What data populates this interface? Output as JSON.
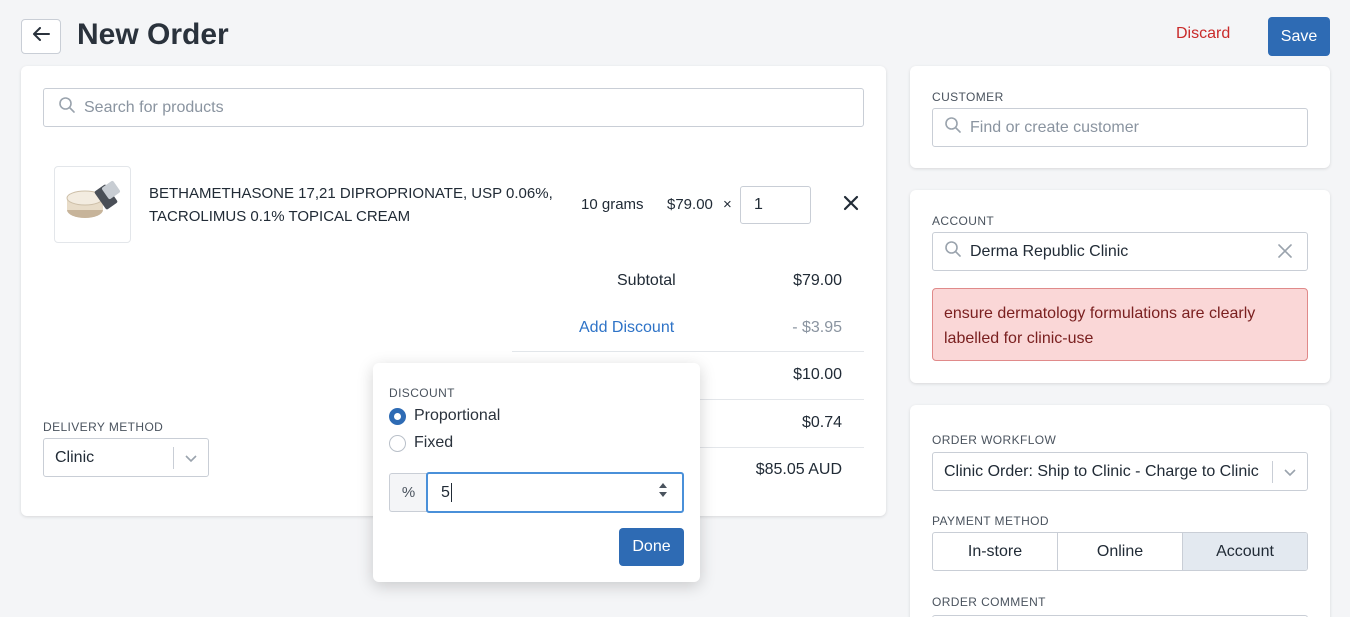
{
  "header": {
    "back_icon": "arrow-left-icon",
    "title": "New Order",
    "discard_label": "Discard",
    "save_label": "Save"
  },
  "colors": {
    "primary": "#2e6bb4",
    "link": "#2e73c7",
    "danger": "#c92a2a",
    "alert_bg": "#fad7d7",
    "alert_border": "#e08a8a",
    "active_segment": "#e3e9f0"
  },
  "products": {
    "search_placeholder": "Search for products",
    "items": [
      {
        "image_icon": "cream-jar-icon",
        "name_line1": "BETHAMETHASONE 17,21 DIPROPRIONATE, USP 0.06%,",
        "name_line2": "TACROLIMUS 0.1% TOPICAL CREAM",
        "size": "10 grams",
        "price": "$79.00",
        "times": "×",
        "quantity": "1"
      }
    ]
  },
  "summary": {
    "subtotal_label": "Subtotal",
    "subtotal_value": "$79.00",
    "discount_link": "Add Discount",
    "discount_value": "- $3.95",
    "shipping_value": "$10.00",
    "tax_value": "$0.74",
    "total_value": "$85.05 AUD"
  },
  "delivery": {
    "label": "DELIVERY METHOD",
    "value": "Clinic"
  },
  "discount_popover": {
    "title": "DISCOUNT",
    "options": [
      {
        "label": "Proportional",
        "selected": true
      },
      {
        "label": "Fixed",
        "selected": false
      }
    ],
    "unit": "%",
    "value": "5",
    "done_label": "Done"
  },
  "customer": {
    "label": "CUSTOMER",
    "placeholder": "Find or create customer"
  },
  "account": {
    "label": "ACCOUNT",
    "value": "Derma Republic Clinic",
    "note": "ensure dermatology formulations are clearly labelled for clinic-use"
  },
  "workflow": {
    "label": "ORDER WORKFLOW",
    "value": "Clinic Order: Ship to Clinic - Charge to Clinic",
    "payment_label": "PAYMENT METHOD",
    "payment_options": [
      {
        "label": "In-store",
        "active": false
      },
      {
        "label": "Online",
        "active": false
      },
      {
        "label": "Account",
        "active": true
      }
    ],
    "comment_label": "ORDER COMMENT"
  }
}
